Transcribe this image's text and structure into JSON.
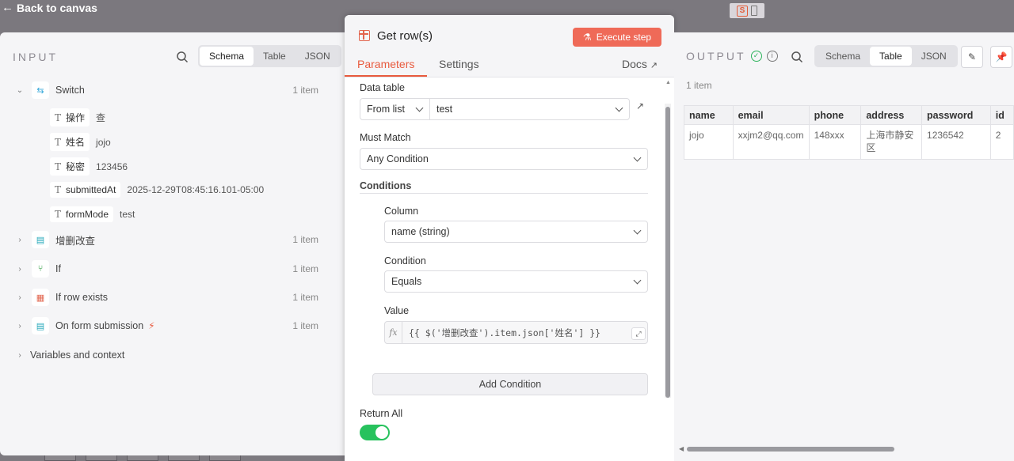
{
  "topbar": {
    "back_label": "Back to canvas"
  },
  "input": {
    "title": "INPUT",
    "view_tabs": [
      "Schema",
      "Table",
      "JSON"
    ],
    "active_tab": "Schema",
    "nodes": [
      {
        "label": "Switch",
        "count": "1 item",
        "icon": "switch-icon",
        "expanded": true,
        "fields": [
          {
            "key": "操作",
            "value": "查"
          },
          {
            "key": "姓名",
            "value": "jojo"
          },
          {
            "key": "秘密",
            "value": "123456"
          },
          {
            "key": "submittedAt",
            "value": "2025-12-29T08:45:16.101-05:00"
          },
          {
            "key": "formMode",
            "value": "test"
          }
        ]
      },
      {
        "label": "增删改查",
        "count": "1 item",
        "icon": "form-icon"
      },
      {
        "label": "If",
        "count": "1 item",
        "icon": "branch-icon"
      },
      {
        "label": "If row exists",
        "count": "1 item",
        "icon": "table-icon"
      },
      {
        "label": "On form submission",
        "count": "1 item",
        "icon": "form-trigger-icon"
      },
      {
        "label": "Variables and context"
      }
    ]
  },
  "node_dialog": {
    "title": "Get row(s)",
    "execute_label": "Execute step",
    "tabs": [
      "Parameters",
      "Settings"
    ],
    "active_tab": "Parameters",
    "docs_label": "Docs",
    "data_table": {
      "label": "Data table",
      "mode": "From list",
      "value": "test"
    },
    "must_match": {
      "label": "Must Match",
      "value": "Any Condition"
    },
    "conditions_label": "Conditions",
    "condition": {
      "column_label": "Column",
      "column_value": "name (string)",
      "condition_label": "Condition",
      "condition_value": "Equals",
      "value_label": "Value",
      "value_expression": "{{ $('增删改查').item.json['姓名'] }}"
    },
    "add_condition_label": "Add Condition",
    "return_all": {
      "label": "Return All",
      "enabled": true
    }
  },
  "output": {
    "title": "OUTPUT",
    "view_tabs": [
      "Schema",
      "Table",
      "JSON"
    ],
    "active_tab": "Table",
    "items_count": "1 item",
    "columns": [
      "name",
      "email",
      "phone",
      "address",
      "password",
      "id"
    ],
    "rows": [
      [
        "jojo",
        "xxjm2@qq.com",
        "148xxx",
        "上海市静安区",
        "1236542",
        "2"
      ]
    ]
  },
  "colors": {
    "accent": "#e85a3e",
    "execute_button": "#ef6a58",
    "toggle_on": "#27c25d"
  }
}
